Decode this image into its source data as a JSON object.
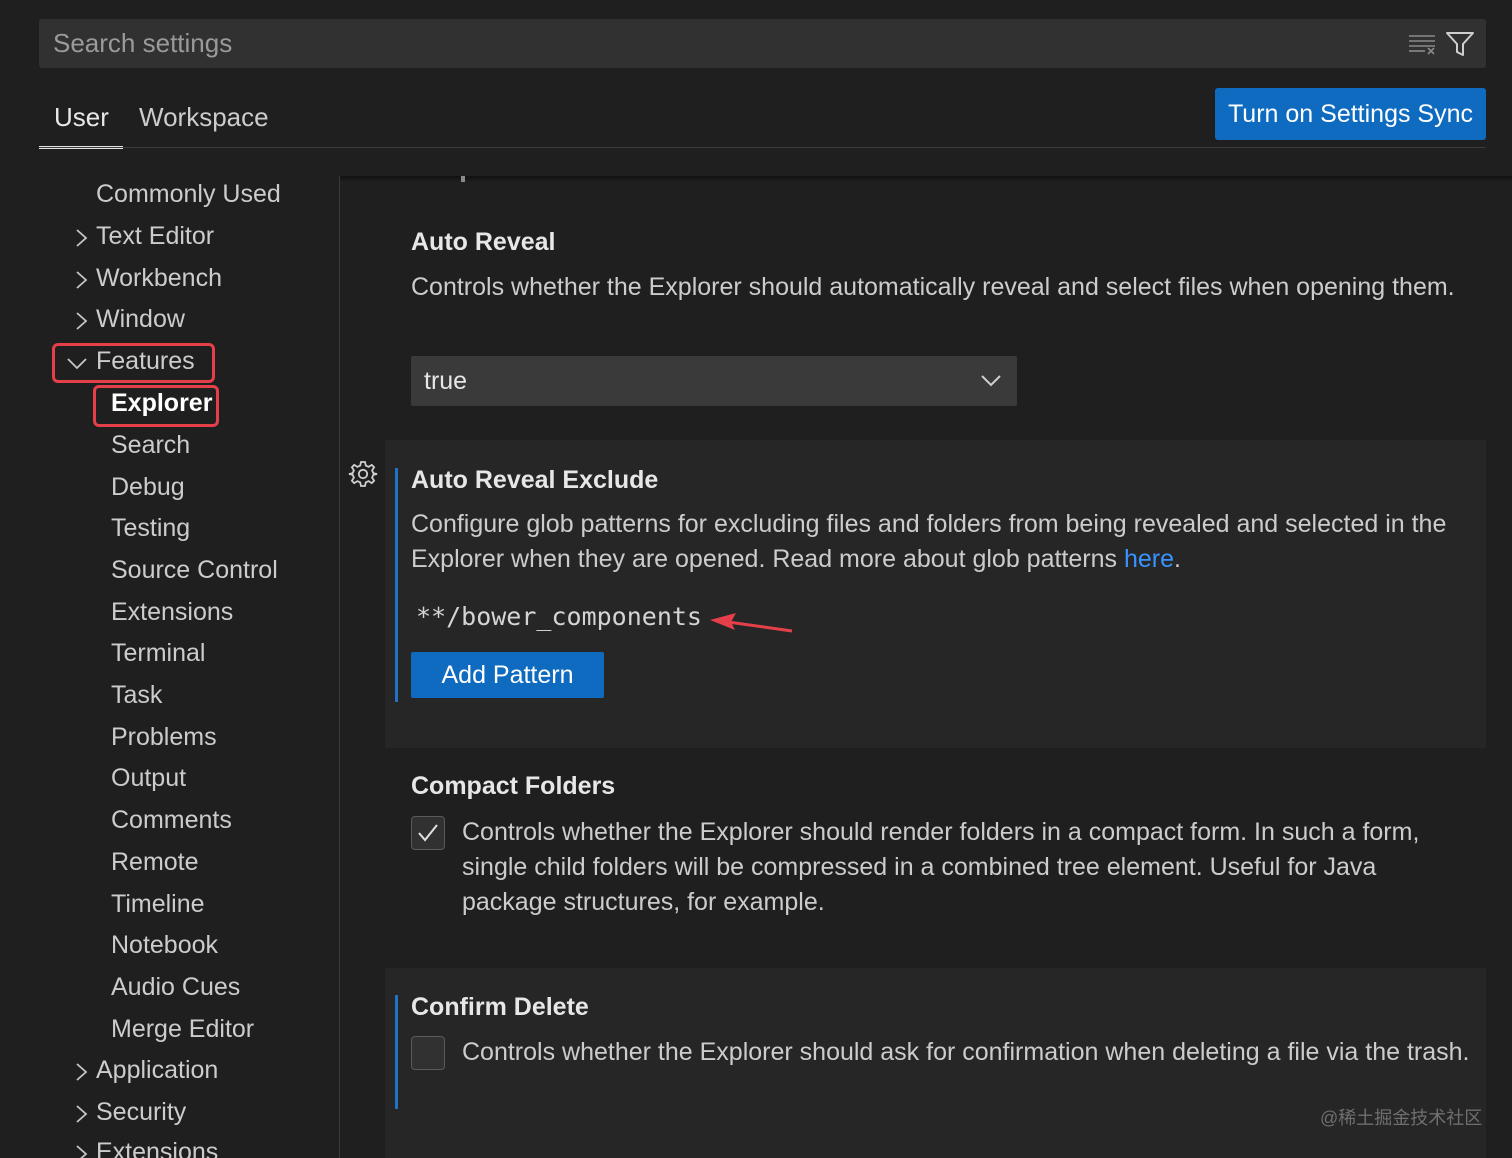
{
  "search": {
    "placeholder": "Search settings"
  },
  "tabs": [
    {
      "label": "User"
    },
    {
      "label": "Workspace"
    }
  ],
  "sync_button": {
    "label": "Turn on Settings Sync"
  },
  "tree": {
    "items": [
      {
        "label": "Commonly Used"
      },
      {
        "label": "Text Editor"
      },
      {
        "label": "Workbench"
      },
      {
        "label": "Window"
      },
      {
        "label": "Features"
      },
      {
        "label": "Explorer"
      },
      {
        "label": "Search"
      },
      {
        "label": "Debug"
      },
      {
        "label": "Testing"
      },
      {
        "label": "Source Control"
      },
      {
        "label": "Extensions"
      },
      {
        "label": "Terminal"
      },
      {
        "label": "Task"
      },
      {
        "label": "Problems"
      },
      {
        "label": "Output"
      },
      {
        "label": "Comments"
      },
      {
        "label": "Remote"
      },
      {
        "label": "Timeline"
      },
      {
        "label": "Notebook"
      },
      {
        "label": "Audio Cues"
      },
      {
        "label": "Merge Editor"
      },
      {
        "label": "Application"
      },
      {
        "label": "Security"
      },
      {
        "label": "Extensions"
      }
    ]
  },
  "settings": {
    "auto_reveal": {
      "title": "Auto Reveal",
      "description": "Controls whether the Explorer should automatically reveal and select files when opening them.",
      "value": "true"
    },
    "auto_reveal_exclude": {
      "title": "Auto Reveal Exclude",
      "description": "Configure glob patterns for excluding files and folders from being revealed and selected in the Explorer when they are opened. Read more about glob patterns ",
      "link_text": "here",
      "description_end": ".",
      "pattern": "**/bower_components",
      "add_button": "Add Pattern"
    },
    "compact_folders": {
      "title": "Compact Folders",
      "description": "Controls whether the Explorer should render folders in a compact form. In such a form, single child folders will be compressed in a combined tree element. Useful for Java package structures, for example.",
      "checked": true
    },
    "confirm_delete": {
      "title": "Confirm Delete",
      "description": "Controls whether the Explorer should ask for confirmation when deleting a file via the trash.",
      "checked": false
    }
  },
  "watermark": "@稀土掘金技术社区",
  "colors": {
    "accent": "#0e6bbf",
    "link": "#3794ff",
    "highlight": "#e5404a",
    "background": "#1f1f1f"
  }
}
